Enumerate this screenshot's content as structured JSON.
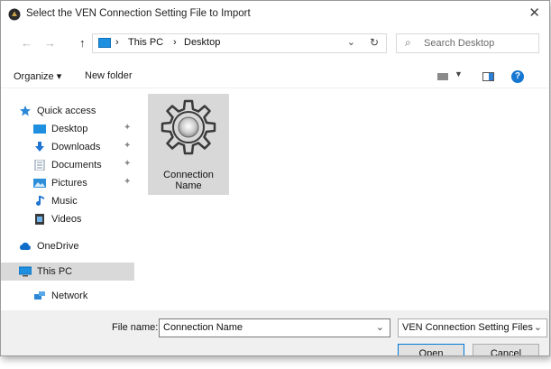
{
  "window": {
    "title": "Select the VEN Connection Setting File to Import",
    "close_glyph": "✕"
  },
  "nav": {
    "back_glyph": "←",
    "forward_glyph": "→",
    "up_glyph": "↑",
    "path": [
      "This PC",
      "Desktop"
    ],
    "separator": "›",
    "dropdown_glyph": "⌄",
    "refresh_glyph": "↻",
    "search_placeholder": "Search Desktop",
    "search_glyph": "⌕"
  },
  "toolbar": {
    "organize_label": "Organize ▾",
    "new_folder_label": "New folder",
    "view_dd_glyph": "▼",
    "help_glyph": "?"
  },
  "sidebar": {
    "quick_access": "Quick access",
    "desktop": "Desktop",
    "downloads": "Downloads",
    "documents": "Documents",
    "pictures": "Pictures",
    "music": "Music",
    "videos": "Videos",
    "onedrive": "OneDrive",
    "this_pc": "This PC",
    "network": "Network",
    "pin_glyph": "📌"
  },
  "files": [
    {
      "name_line1": "Connection",
      "name_line2": "Name",
      "icon": "gear-icon"
    }
  ],
  "footer": {
    "file_name_label": "File name:",
    "file_name_value": "Connection Name",
    "dropdown_glyph": "⌄",
    "file_type_value": "VEN Connection Setting Files (*",
    "open_label": "Open",
    "cancel_label": "Cancel"
  },
  "colors": {
    "accent": "#0078d7",
    "selection": "#d9d9d9",
    "footer_bg": "#f0f0f0"
  }
}
